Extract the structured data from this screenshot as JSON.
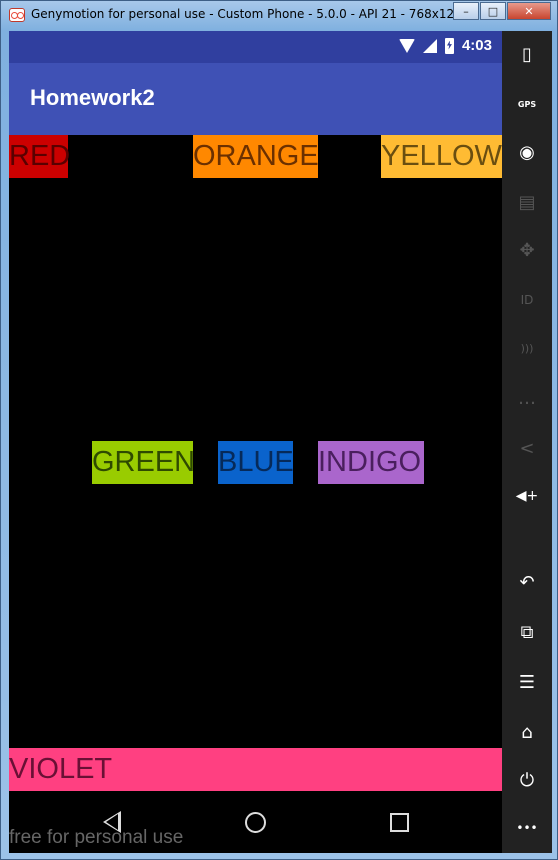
{
  "window": {
    "title": "Genymotion for personal use - Custom Phone - 5.0.0 - API 21 - 768x12...",
    "minimize": "–",
    "maximize": "□",
    "close": "✕"
  },
  "statusbar": {
    "time": "4:03"
  },
  "app": {
    "title": "Homework2"
  },
  "labels": {
    "red": "RED",
    "orange": "ORANGE",
    "yellow": "YELLOW",
    "green": "GREEN",
    "blue": "BLUE",
    "indigo": "INDIGO",
    "violet": "VIOLET"
  },
  "watermark": "free for personal use",
  "colors": {
    "statusbar": "#303f9f",
    "actionbar": "#3f51b5",
    "red": "#cc0000",
    "orange": "#ff8800",
    "yellow": "#ffbb33",
    "green": "#99cc00",
    "blue": "#0a63cc",
    "indigo": "#aa66cc",
    "violet": "#ff4081"
  },
  "toolbar": {
    "battery": "▯",
    "gps": "GPS",
    "camera": "◉",
    "clapper": "▤",
    "move": "✥",
    "id": "ID",
    "rss": ")))",
    "sms": "…",
    "share": "<",
    "volume": "◀+",
    "back": "↶",
    "recent": "⧉",
    "menu": "☰",
    "home": "⌂",
    "power": "⏻",
    "more": "•••"
  }
}
